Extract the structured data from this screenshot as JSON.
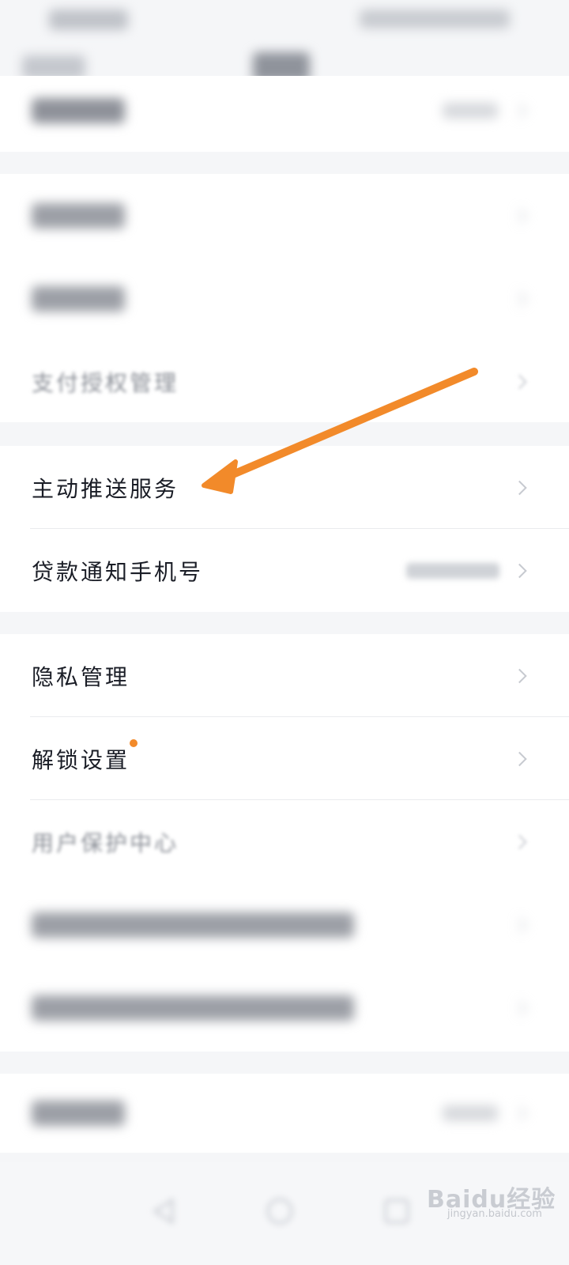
{
  "groups": {
    "mid": {
      "rows": [
        {
          "label": "支付授权管理"
        }
      ]
    },
    "push": {
      "rows": [
        {
          "label": "主动推送服务"
        },
        {
          "label": "贷款通知手机号"
        }
      ]
    },
    "privacy": {
      "rows": [
        {
          "label": "隐私管理"
        },
        {
          "label": "解锁设置"
        },
        {
          "label": "用户保护中心"
        }
      ]
    }
  },
  "colors": {
    "accent_arrow": "#f28a2a",
    "notification_dot": "#f28a2a",
    "row_background": "#ffffff",
    "page_background": "#f5f6f8"
  },
  "icons": {
    "row_chevron": "chevron-right-icon",
    "nav_back": "back-triangle-icon",
    "nav_home": "home-circle-icon",
    "nav_recent": "recent-square-icon"
  },
  "watermark": {
    "main": "Baidu经验",
    "sub": "jingyan.baidu.com"
  }
}
